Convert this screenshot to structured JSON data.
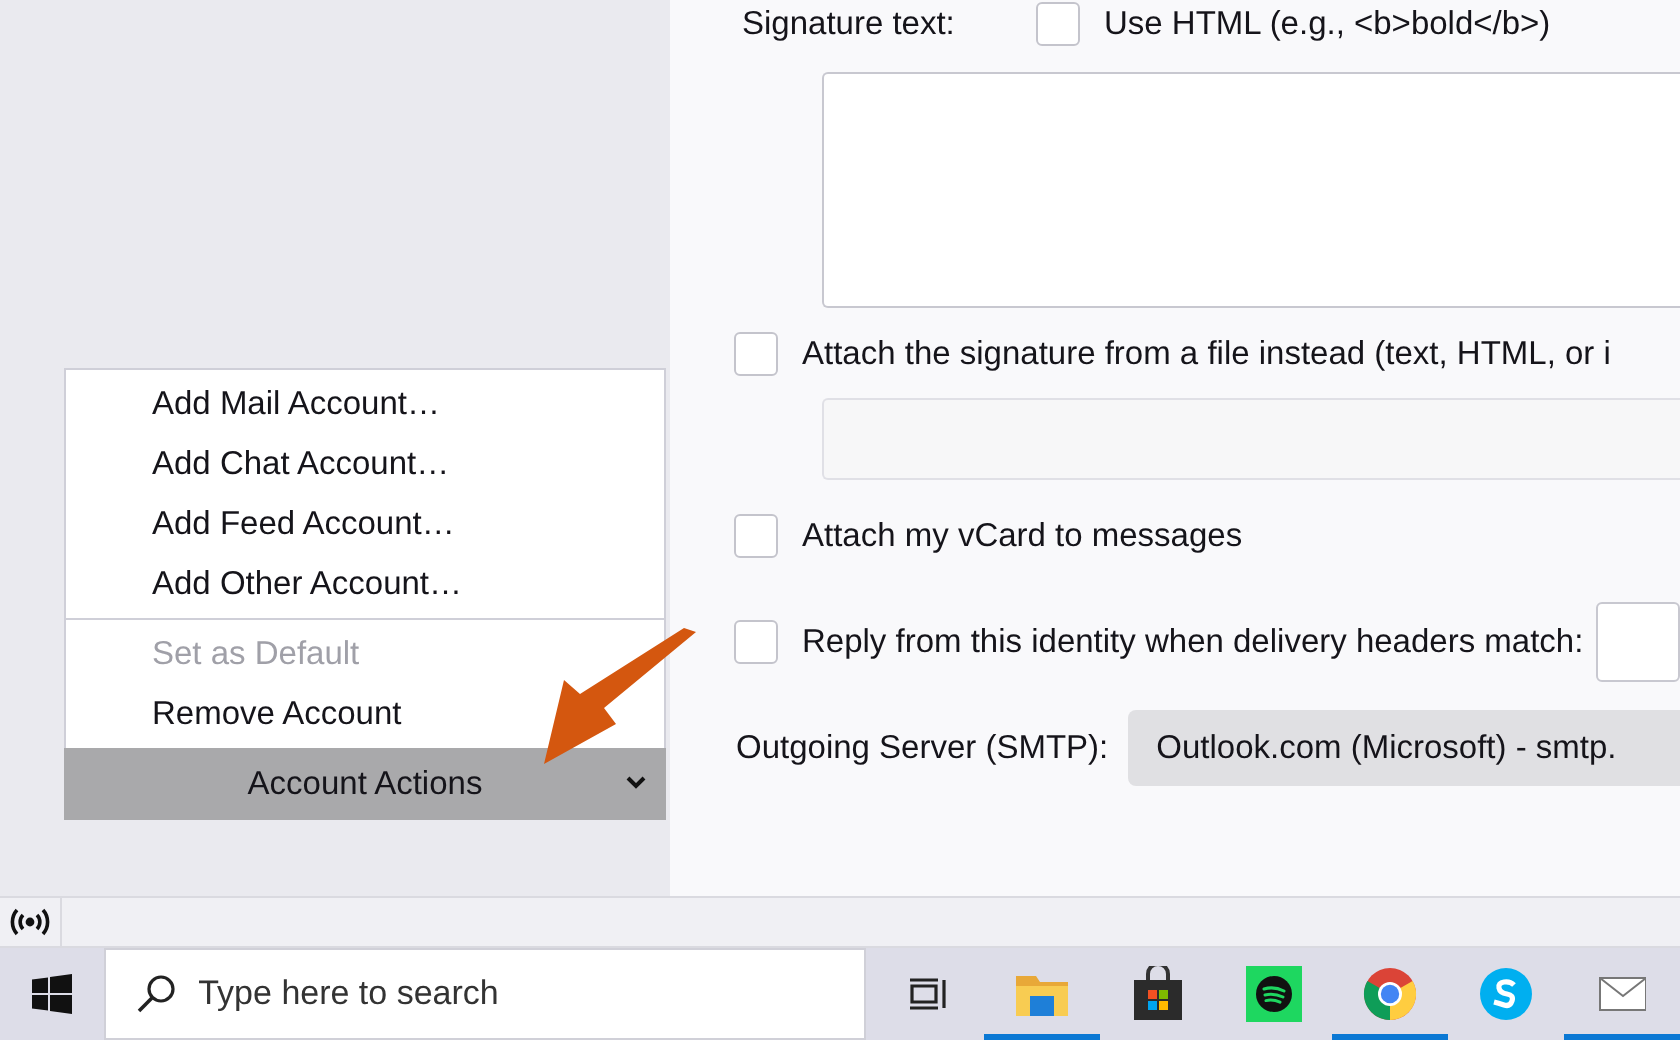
{
  "menu": {
    "groups": [
      [
        {
          "label": "Add Mail Account…",
          "disabled": false
        },
        {
          "label": "Add Chat Account…",
          "disabled": false
        },
        {
          "label": "Add Feed Account…",
          "disabled": false
        },
        {
          "label": "Add Other Account…",
          "disabled": false
        }
      ],
      [
        {
          "label": "Set as Default",
          "disabled": true
        },
        {
          "label": "Remove Account",
          "disabled": false
        }
      ]
    ]
  },
  "account_actions_button": {
    "label": "Account Actions"
  },
  "signature": {
    "label": "Signature text:",
    "use_html": {
      "label": "Use HTML (e.g., <b>bold</b>)",
      "checked": false
    }
  },
  "options": [
    {
      "kind": "checkbox",
      "label": "Attach the signature from a file instead (text, HTML, or i",
      "checked": false
    },
    {
      "kind": "file-field"
    },
    {
      "kind": "checkbox",
      "label": "Attach my vCard to messages",
      "checked": false
    },
    {
      "kind": "checkbox-field",
      "label": "Reply from this identity when delivery headers match:",
      "checked": false
    }
  ],
  "outgoing_server": {
    "label": "Outgoing Server (SMTP):",
    "value": "Outlook.com (Microsoft) - smtp."
  },
  "taskbar": {
    "search": {
      "placeholder": "Type here to search"
    },
    "apps": [
      {
        "kind": "task-view",
        "running": false
      },
      {
        "kind": "file-explorer",
        "running": true
      },
      {
        "kind": "store",
        "running": false
      },
      {
        "kind": "music",
        "running": false
      },
      {
        "kind": "browser",
        "running": true
      },
      {
        "kind": "chat",
        "running": false
      },
      {
        "kind": "mail",
        "running": true
      }
    ]
  }
}
